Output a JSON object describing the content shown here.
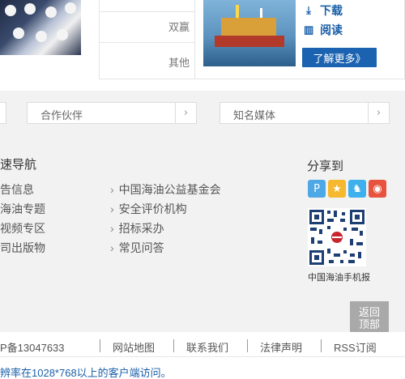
{
  "featured": {
    "categories": [
      "双赢",
      "其他"
    ],
    "actions": [
      {
        "label": "下载",
        "icon": "download-icon"
      },
      {
        "label": "阅读",
        "icon": "book-icon"
      }
    ],
    "more_label": "了解更多》"
  },
  "selectors": [
    {
      "label": "",
      "arrow": "›"
    },
    {
      "label": "合作伙伴",
      "arrow": "›"
    },
    {
      "label": "知名媒体",
      "arrow": "›"
    }
  ],
  "quick_nav": {
    "title": "速导航",
    "left_links": [
      "告信息",
      "海油专题",
      "视频专区",
      "司出版物"
    ],
    "right_links": [
      "中国海油公益基金会",
      "安全评价机构",
      "招标采办",
      "常见问答"
    ]
  },
  "share": {
    "title": "分享到",
    "icons": [
      {
        "name": "pinterest-icon",
        "glyph": "P",
        "color": "#4ea8e5"
      },
      {
        "name": "star-icon",
        "glyph": "★",
        "color": "#f5b82e"
      },
      {
        "name": "qq-icon",
        "glyph": "♞",
        "color": "#3eb0ee"
      },
      {
        "name": "weibo-icon",
        "glyph": "◉",
        "color": "#e8533f"
      }
    ],
    "qr_caption": "中国海油手机报"
  },
  "back_to_top": {
    "line1": "返回",
    "line2": "顶部"
  },
  "footer": {
    "icp": "P备13047633",
    "links": [
      "网站地图",
      "联系我们",
      "法律声明",
      "RSS订阅"
    ],
    "notice": "辨率在1028*768以上的客户端访问。"
  },
  "colors": {
    "link_blue": "#1a5fa8",
    "button_blue": "#1b63b0",
    "section_gray": "#f2f2f2",
    "back_top_gray": "#a9a9a9"
  }
}
